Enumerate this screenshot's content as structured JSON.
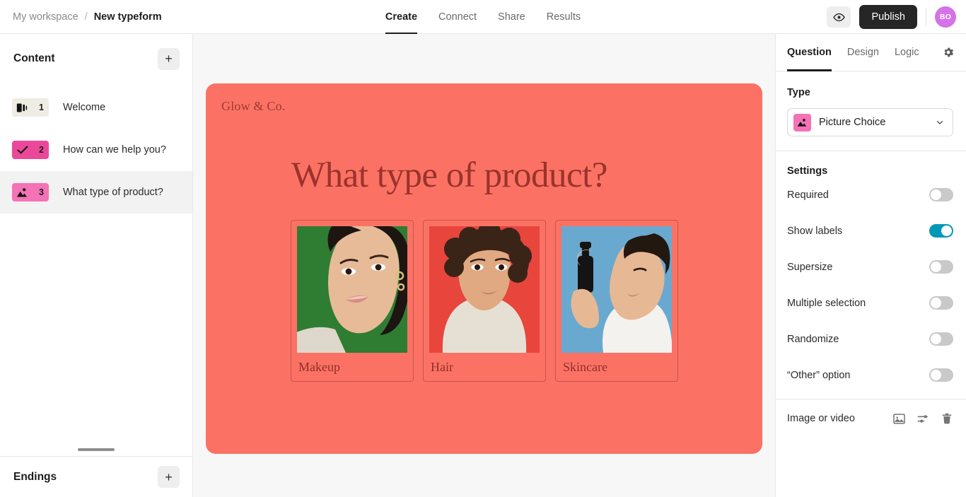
{
  "topbar": {
    "workspace": "My workspace",
    "separator": "/",
    "form_name": "New typeform",
    "tabs": [
      {
        "label": "Create",
        "active": true
      },
      {
        "label": "Connect",
        "active": false
      },
      {
        "label": "Share",
        "active": false
      },
      {
        "label": "Results",
        "active": false
      }
    ],
    "preview_icon": "eye-icon",
    "publish_label": "Publish",
    "avatar_initials": "BO",
    "avatar_color": "#d572e8"
  },
  "sidebar": {
    "title": "Content",
    "add_label": "+",
    "questions": [
      {
        "number": "1",
        "label": "Welcome",
        "icon": "welcome-screen-icon",
        "badge_color": "#efece4",
        "selected": false
      },
      {
        "number": "2",
        "label": "How can we help you?",
        "icon": "check-icon",
        "badge_color": "#ec4899",
        "selected": false
      },
      {
        "number": "3",
        "label": "What type of product?",
        "icon": "picture-icon",
        "badge_color": "#f472b6",
        "selected": true
      }
    ],
    "endings_title": "Endings",
    "endings_add_label": "+"
  },
  "canvas": {
    "background_color": "#fb7265",
    "brand": "Glow & Co.",
    "question_title": "What type of product?",
    "choices": [
      {
        "label": "Makeup",
        "photo_bg": "#2e7d32",
        "alt": "woman-face-green-background"
      },
      {
        "label": "Hair",
        "photo_bg": "#e8453c",
        "alt": "woman-curly-hair-red-background"
      },
      {
        "label": "Skincare",
        "photo_bg": "#6aa9cf",
        "alt": "man-spraying-face-blue-background"
      }
    ]
  },
  "right_panel": {
    "tabs": [
      {
        "label": "Question",
        "active": true
      },
      {
        "label": "Design",
        "active": false
      },
      {
        "label": "Logic",
        "active": false
      }
    ],
    "settings_icon": "gear-icon",
    "type_heading": "Type",
    "type_value": "Picture Choice",
    "type_icon": "picture-icon",
    "chevron_icon": "chevron-down-icon",
    "settings_heading": "Settings",
    "settings": [
      {
        "label": "Required",
        "on": false
      },
      {
        "label": "Show labels",
        "on": true
      },
      {
        "label": "Supersize",
        "on": false
      },
      {
        "label": "Multiple selection",
        "on": false
      },
      {
        "label": "Randomize",
        "on": false
      },
      {
        "label": "“Other” option",
        "on": false
      }
    ],
    "toggle_on_color": "#0098b8",
    "media_label": "Image or video",
    "media_icons": [
      "image-icon",
      "adjust-sliders-icon",
      "trash-icon"
    ]
  }
}
